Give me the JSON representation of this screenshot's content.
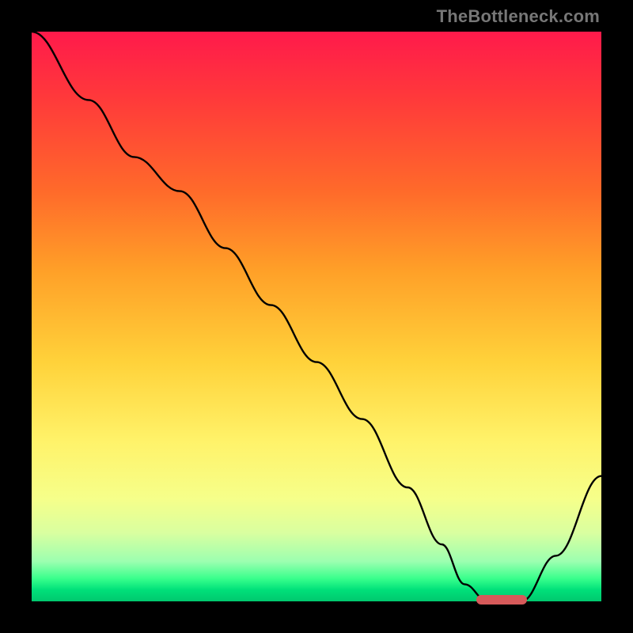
{
  "watermark": {
    "text": "TheBottleneck.com"
  },
  "chart_data": {
    "type": "line",
    "title": "",
    "xlabel": "",
    "ylabel": "",
    "xlim": [
      0,
      100
    ],
    "ylim": [
      0,
      100
    ],
    "grid": false,
    "legend": false,
    "background_gradient": {
      "orientation": "vertical",
      "stops": [
        {
          "pos": 0.0,
          "color": "#ff1a4b"
        },
        {
          "pos": 0.5,
          "color": "#ffd23a"
        },
        {
          "pos": 0.85,
          "color": "#f6ff8a"
        },
        {
          "pos": 1.0,
          "color": "#00c86e"
        }
      ]
    },
    "series": [
      {
        "name": "bottleneck-curve",
        "x": [
          0,
          10,
          18,
          26,
          34,
          42,
          50,
          58,
          66,
          72,
          76,
          80,
          86,
          92,
          100
        ],
        "y": [
          100,
          88,
          78,
          72,
          62,
          52,
          42,
          32,
          20,
          10,
          3,
          0,
          0,
          8,
          22
        ]
      }
    ],
    "optimal_marker": {
      "x_start": 78,
      "x_end": 87,
      "y": 0,
      "color": "#d65a5a"
    }
  }
}
